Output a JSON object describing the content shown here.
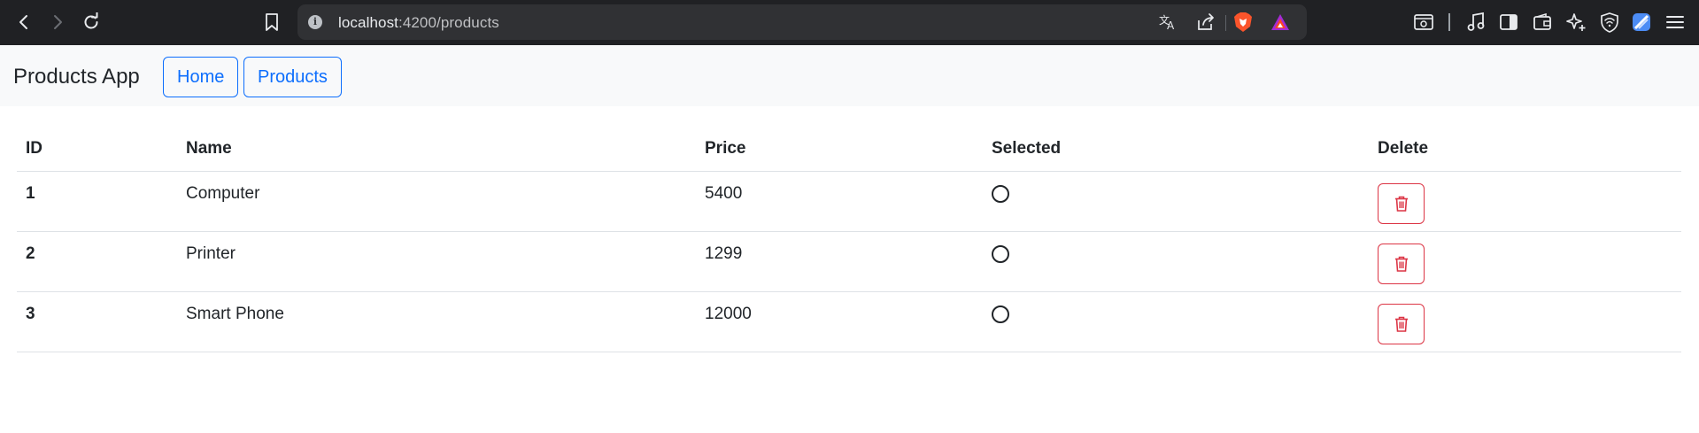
{
  "browser": {
    "url_host": "localhost",
    "url_path": ":4200/products",
    "icons": [
      "back-icon",
      "forward-icon",
      "reload-icon",
      "bookmark-icon",
      "site-info-icon",
      "translate-icon",
      "share-icon",
      "brave-shields-icon",
      "brave-rewards-icon",
      "reader-mode-icon",
      "media-icon",
      "sidebar-icon",
      "wallet-icon",
      "leo-ai-icon",
      "vpn-icon",
      "profile-icon",
      "menu-icon"
    ]
  },
  "navbar": {
    "brand": "Products App",
    "links": [
      {
        "label": "Home"
      },
      {
        "label": "Products"
      }
    ]
  },
  "table": {
    "headers": {
      "id": "ID",
      "name": "Name",
      "price": "Price",
      "selected": "Selected",
      "delete": "Delete"
    },
    "rows": [
      {
        "id": "1",
        "name": "Computer",
        "price": "5400",
        "selected": false
      },
      {
        "id": "2",
        "name": "Printer",
        "price": "1299",
        "selected": false
      },
      {
        "id": "3",
        "name": "Smart Phone",
        "price": "12000",
        "selected": false
      }
    ]
  },
  "colors": {
    "primary": "#0d6efd",
    "danger": "#dc3545",
    "navbar_bg": "#f8f9fa",
    "chrome_bg": "#202124"
  }
}
